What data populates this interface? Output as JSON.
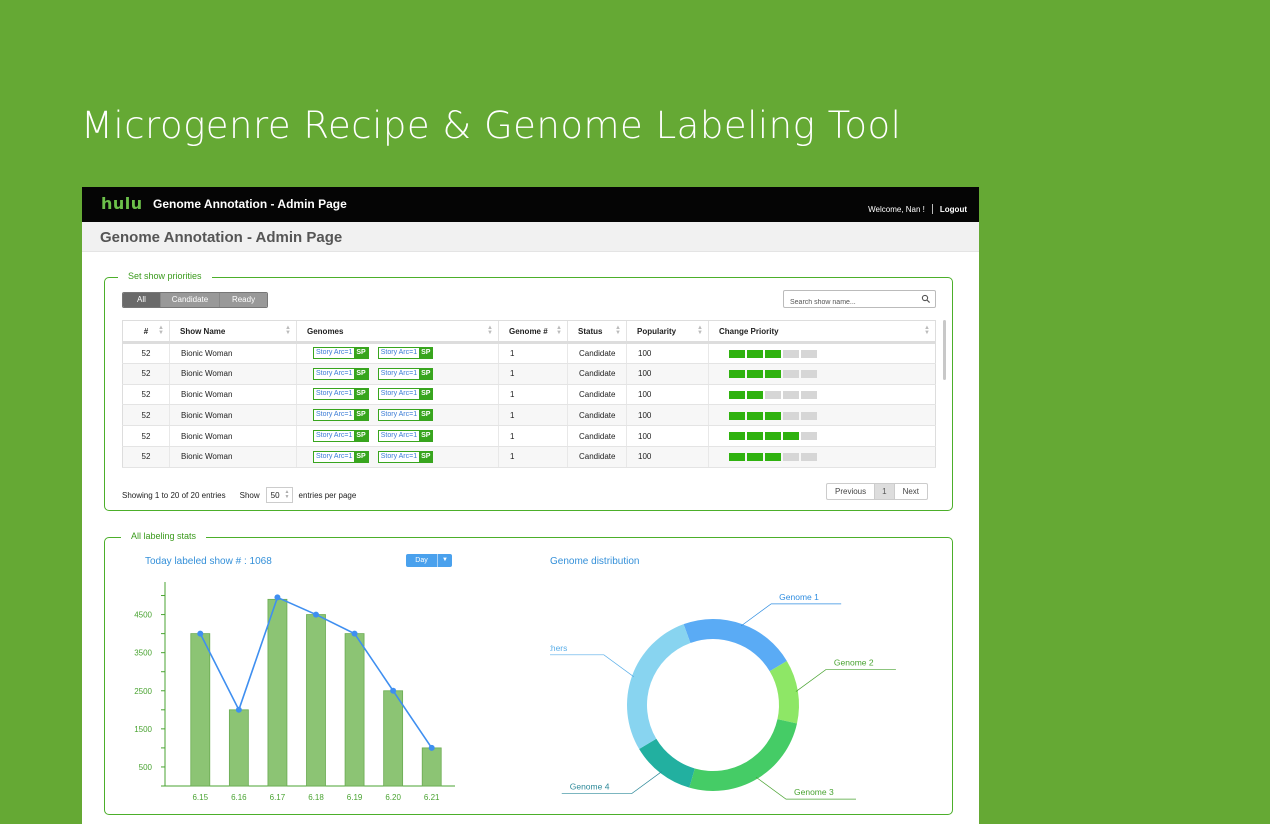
{
  "hero": {
    "title": "Microgenre Recipe & Genome Labeling Tool"
  },
  "topbar": {
    "logo": "hulu",
    "app_title": "Genome Annotation - Admin Page",
    "welcome": "Welcome, Nan !",
    "logout": "Logout"
  },
  "page": {
    "title": "Genome Annotation - Admin Page"
  },
  "priorities": {
    "legend": "Set show priorities",
    "filters": [
      {
        "label": "All",
        "active": true
      },
      {
        "label": "Candidate",
        "active": false
      },
      {
        "label": "Ready",
        "active": false
      }
    ],
    "search_placeholder": "Search show name...",
    "columns": [
      "#",
      "Show Name",
      "Genomes",
      "Genome #",
      "Status",
      "Popularity",
      "Change Priority"
    ],
    "rows": [
      {
        "num": "52",
        "name": "Bionic Woman",
        "genomes": [
          "Story Arc=1",
          "Story Arc=1"
        ],
        "genome_count": "1",
        "status": "Candidate",
        "popularity": "100",
        "priority": 3
      },
      {
        "num": "52",
        "name": "Bionic Woman",
        "genomes": [
          "Story Arc=1",
          "Story Arc=1"
        ],
        "genome_count": "1",
        "status": "Candidate",
        "popularity": "100",
        "priority": 3
      },
      {
        "num": "52",
        "name": "Bionic Woman",
        "genomes": [
          "Story Arc=1",
          "Story Arc=1"
        ],
        "genome_count": "1",
        "status": "Candidate",
        "popularity": "100",
        "priority": 2
      },
      {
        "num": "52",
        "name": "Bionic Woman",
        "genomes": [
          "Story Arc=1",
          "Story Arc=1"
        ],
        "genome_count": "1",
        "status": "Candidate",
        "popularity": "100",
        "priority": 3
      },
      {
        "num": "52",
        "name": "Bionic Woman",
        "genomes": [
          "Story Arc=1",
          "Story Arc=1"
        ],
        "genome_count": "1",
        "status": "Candidate",
        "popularity": "100",
        "priority": 4
      },
      {
        "num": "52",
        "name": "Bionic Woman",
        "genomes": [
          "Story Arc=1",
          "Story Arc=1"
        ],
        "genome_count": "1",
        "status": "Candidate",
        "popularity": "100",
        "priority": 3
      }
    ],
    "tag_suffix": "SP",
    "priority_max": 5,
    "showing": "Showing 1 to 20 of 20 entries",
    "show_label": "Show",
    "page_size": "50",
    "per_page_label": "entries per page",
    "pager": {
      "previous": "Previous",
      "current": "1",
      "next": "Next"
    }
  },
  "stats": {
    "legend": "All labeling stats",
    "today_label": "Today labeled show # : 1068",
    "range_button": "Day",
    "genome_title": "Genome distribution"
  },
  "chart_data": [
    {
      "type": "bar",
      "categories": [
        "6.15",
        "6.16",
        "6.17",
        "6.18",
        "6.19",
        "6.20",
        "6.21"
      ],
      "series": [
        {
          "type": "bar",
          "values": [
            4000,
            2000,
            4900,
            4500,
            4000,
            2500,
            1000
          ]
        },
        {
          "type": "line",
          "values": [
            4000,
            2000,
            4950,
            4500,
            4000,
            2500,
            1000
          ]
        }
      ],
      "yticks": [
        500,
        1500,
        2500,
        3500,
        4500
      ],
      "ylim": [
        0,
        5250
      ],
      "colors": {
        "bar": "#8cc474",
        "bar_edge": "#6aab52",
        "line": "#3f8ff0",
        "axis": "#49a331"
      }
    },
    {
      "type": "pie",
      "title": "Genome distribution",
      "labels": [
        "Genome 1",
        "Genome 2",
        "Genome 3",
        "Genome 4",
        "Others"
      ],
      "values": [
        22,
        12,
        26,
        12,
        28
      ],
      "colors": [
        "#5aabf5",
        "#8ee766",
        "#45cc66",
        "#22b0a0",
        "#88d4f0"
      ],
      "label_colors": [
        "#2f8de0",
        "#49a331",
        "#49a331",
        "#2f8a9a",
        "#5aaee8"
      ]
    }
  ]
}
